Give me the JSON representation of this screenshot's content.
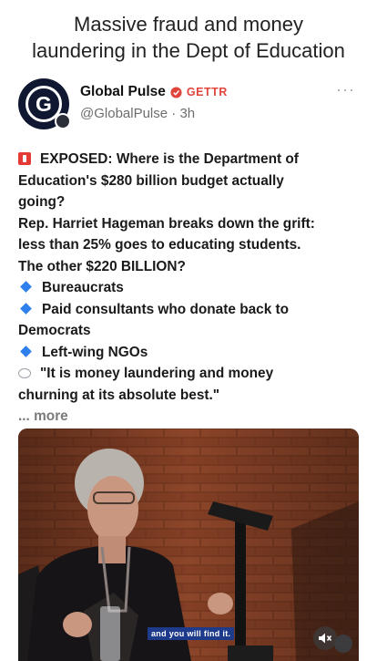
{
  "caption": {
    "line1": "Massive fraud and money",
    "line2": "laundering in the Dept of Education"
  },
  "post": {
    "display_name": "Global Pulse",
    "platform": "GETTR",
    "handle": "@GlobalPulse",
    "separator": "·",
    "time": "3h",
    "more_menu": "···",
    "icons": {
      "avatar": "globe-logo-icon",
      "verified": "verified-badge-icon",
      "lead": "red-alert-icon",
      "bullet": "blue-diamond-icon",
      "quote": "speech-bubble-icon"
    },
    "body": {
      "line1": "EXPOSED: Where is the Department of",
      "line2": "Education's $280 billion budget actually",
      "line3": "going?",
      "line4": "Rep. Harriet Hageman breaks down the grift:",
      "line5": "less than 25% goes to educating students.",
      "line6": "The other $220 BILLION?",
      "bullet1": "Bureaucrats",
      "bullet2a": "Paid consultants who donate back to",
      "bullet2b": "Democrats",
      "bullet3": "Left-wing NGOs",
      "quote_a": "\"It is money laundering and money",
      "quote_b": "churning at its absolute best.\"",
      "more": "... more"
    }
  },
  "video": {
    "subtitle": "and you will find it.",
    "mute_icon": "speaker-muted-icon"
  },
  "colors": {
    "platform": "#e0443c",
    "bullet": "#2f80ed",
    "subtitle_bg": "#1e3a8a"
  }
}
